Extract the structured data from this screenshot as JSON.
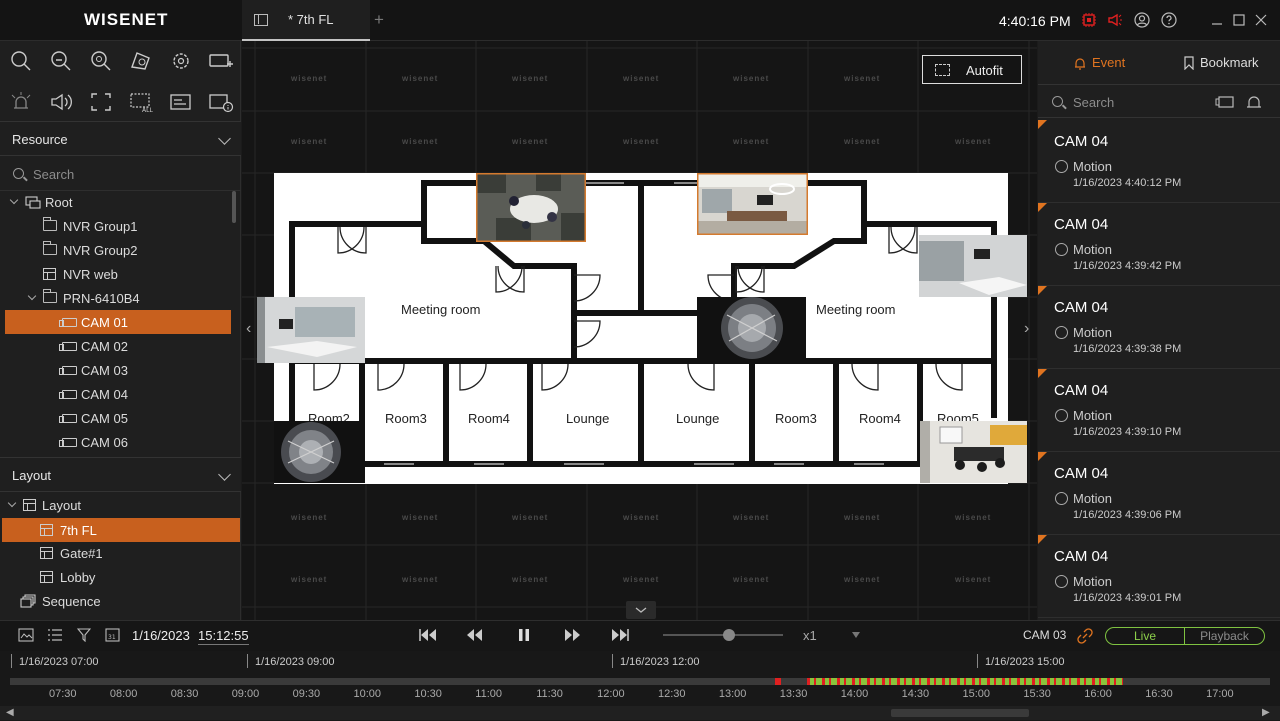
{
  "app": {
    "logo": "WISENET",
    "clock": "4:40:16 PM"
  },
  "tabs": [
    {
      "label": "* 7th FL"
    }
  ],
  "resource": {
    "header": "Resource",
    "search_placeholder": "Search",
    "tree": [
      {
        "label": "Root",
        "icon": "recorder-icon",
        "level": 0
      },
      {
        "label": "NVR Group1",
        "icon": "folder-icon",
        "level": 1
      },
      {
        "label": "NVR Group2",
        "icon": "folder-icon",
        "level": 1
      },
      {
        "label": "NVR web",
        "icon": "web-icon",
        "level": 1
      },
      {
        "label": "PRN-6410B4",
        "icon": "folder-icon",
        "level": 1
      },
      {
        "label": "CAM 01",
        "icon": "camera-icon",
        "level": 2,
        "selected": true
      },
      {
        "label": "CAM 02",
        "icon": "camera-icon",
        "level": 2
      },
      {
        "label": "CAM 03",
        "icon": "camera-icon",
        "level": 2
      },
      {
        "label": "CAM 04",
        "icon": "camera-icon",
        "level": 2
      },
      {
        "label": "CAM 05",
        "icon": "camera-icon",
        "level": 2
      },
      {
        "label": "CAM 06",
        "icon": "camera-icon",
        "level": 2
      }
    ]
  },
  "layout": {
    "header": "Layout",
    "tree": [
      {
        "label": "Layout",
        "level": 0
      },
      {
        "label": "7th FL",
        "level": 1,
        "selected": true
      },
      {
        "label": "Gate#1",
        "level": 1
      },
      {
        "label": "Lobby",
        "level": 1
      },
      {
        "label": "Sequence",
        "level": 0
      }
    ]
  },
  "center": {
    "autofit_label": "Autofit",
    "watermark": "wisenet",
    "rooms": [
      "Meeting room",
      "Meeting room",
      "Room2",
      "Room3",
      "Room4",
      "Lounge",
      "Lounge",
      "Room3",
      "Room4",
      "Room5"
    ]
  },
  "events": {
    "tab_event": "Event",
    "tab_bookmark": "Bookmark",
    "search_placeholder": "Search",
    "items": [
      {
        "camera": "CAM 04",
        "type": "Motion",
        "time": "1/16/2023 4:40:12 PM"
      },
      {
        "camera": "CAM 04",
        "type": "Motion",
        "time": "1/16/2023 4:39:42 PM"
      },
      {
        "camera": "CAM 04",
        "type": "Motion",
        "time": "1/16/2023 4:39:38 PM"
      },
      {
        "camera": "CAM 04",
        "type": "Motion",
        "time": "1/16/2023 4:39:10 PM"
      },
      {
        "camera": "CAM 04",
        "type": "Motion",
        "time": "1/16/2023 4:39:06 PM"
      },
      {
        "camera": "CAM 04",
        "type": "Motion",
        "time": "1/16/2023 4:39:01 PM"
      }
    ]
  },
  "playback": {
    "date": "1/16/2023",
    "time": "15:12:55",
    "speed": "x1",
    "camera": "CAM 03",
    "live_label": "Live",
    "playback_label": "Playback"
  },
  "timeline": {
    "dates": [
      "1/16/2023 07:00",
      "1/16/2023 09:00",
      "1/16/2023 12:00",
      "1/16/2023 15:00"
    ],
    "ticks": [
      "07:30",
      "08:00",
      "08:30",
      "09:00",
      "09:30",
      "10:00",
      "10:30",
      "11:00",
      "11:30",
      "12:00",
      "12:30",
      "13:00",
      "13:30",
      "14:00",
      "14:30",
      "15:00",
      "15:30",
      "16:00",
      "16:30",
      "17:00"
    ]
  },
  "colors": {
    "accent": "#c8601e",
    "live": "#7fc241",
    "event_red": "#e02020"
  }
}
